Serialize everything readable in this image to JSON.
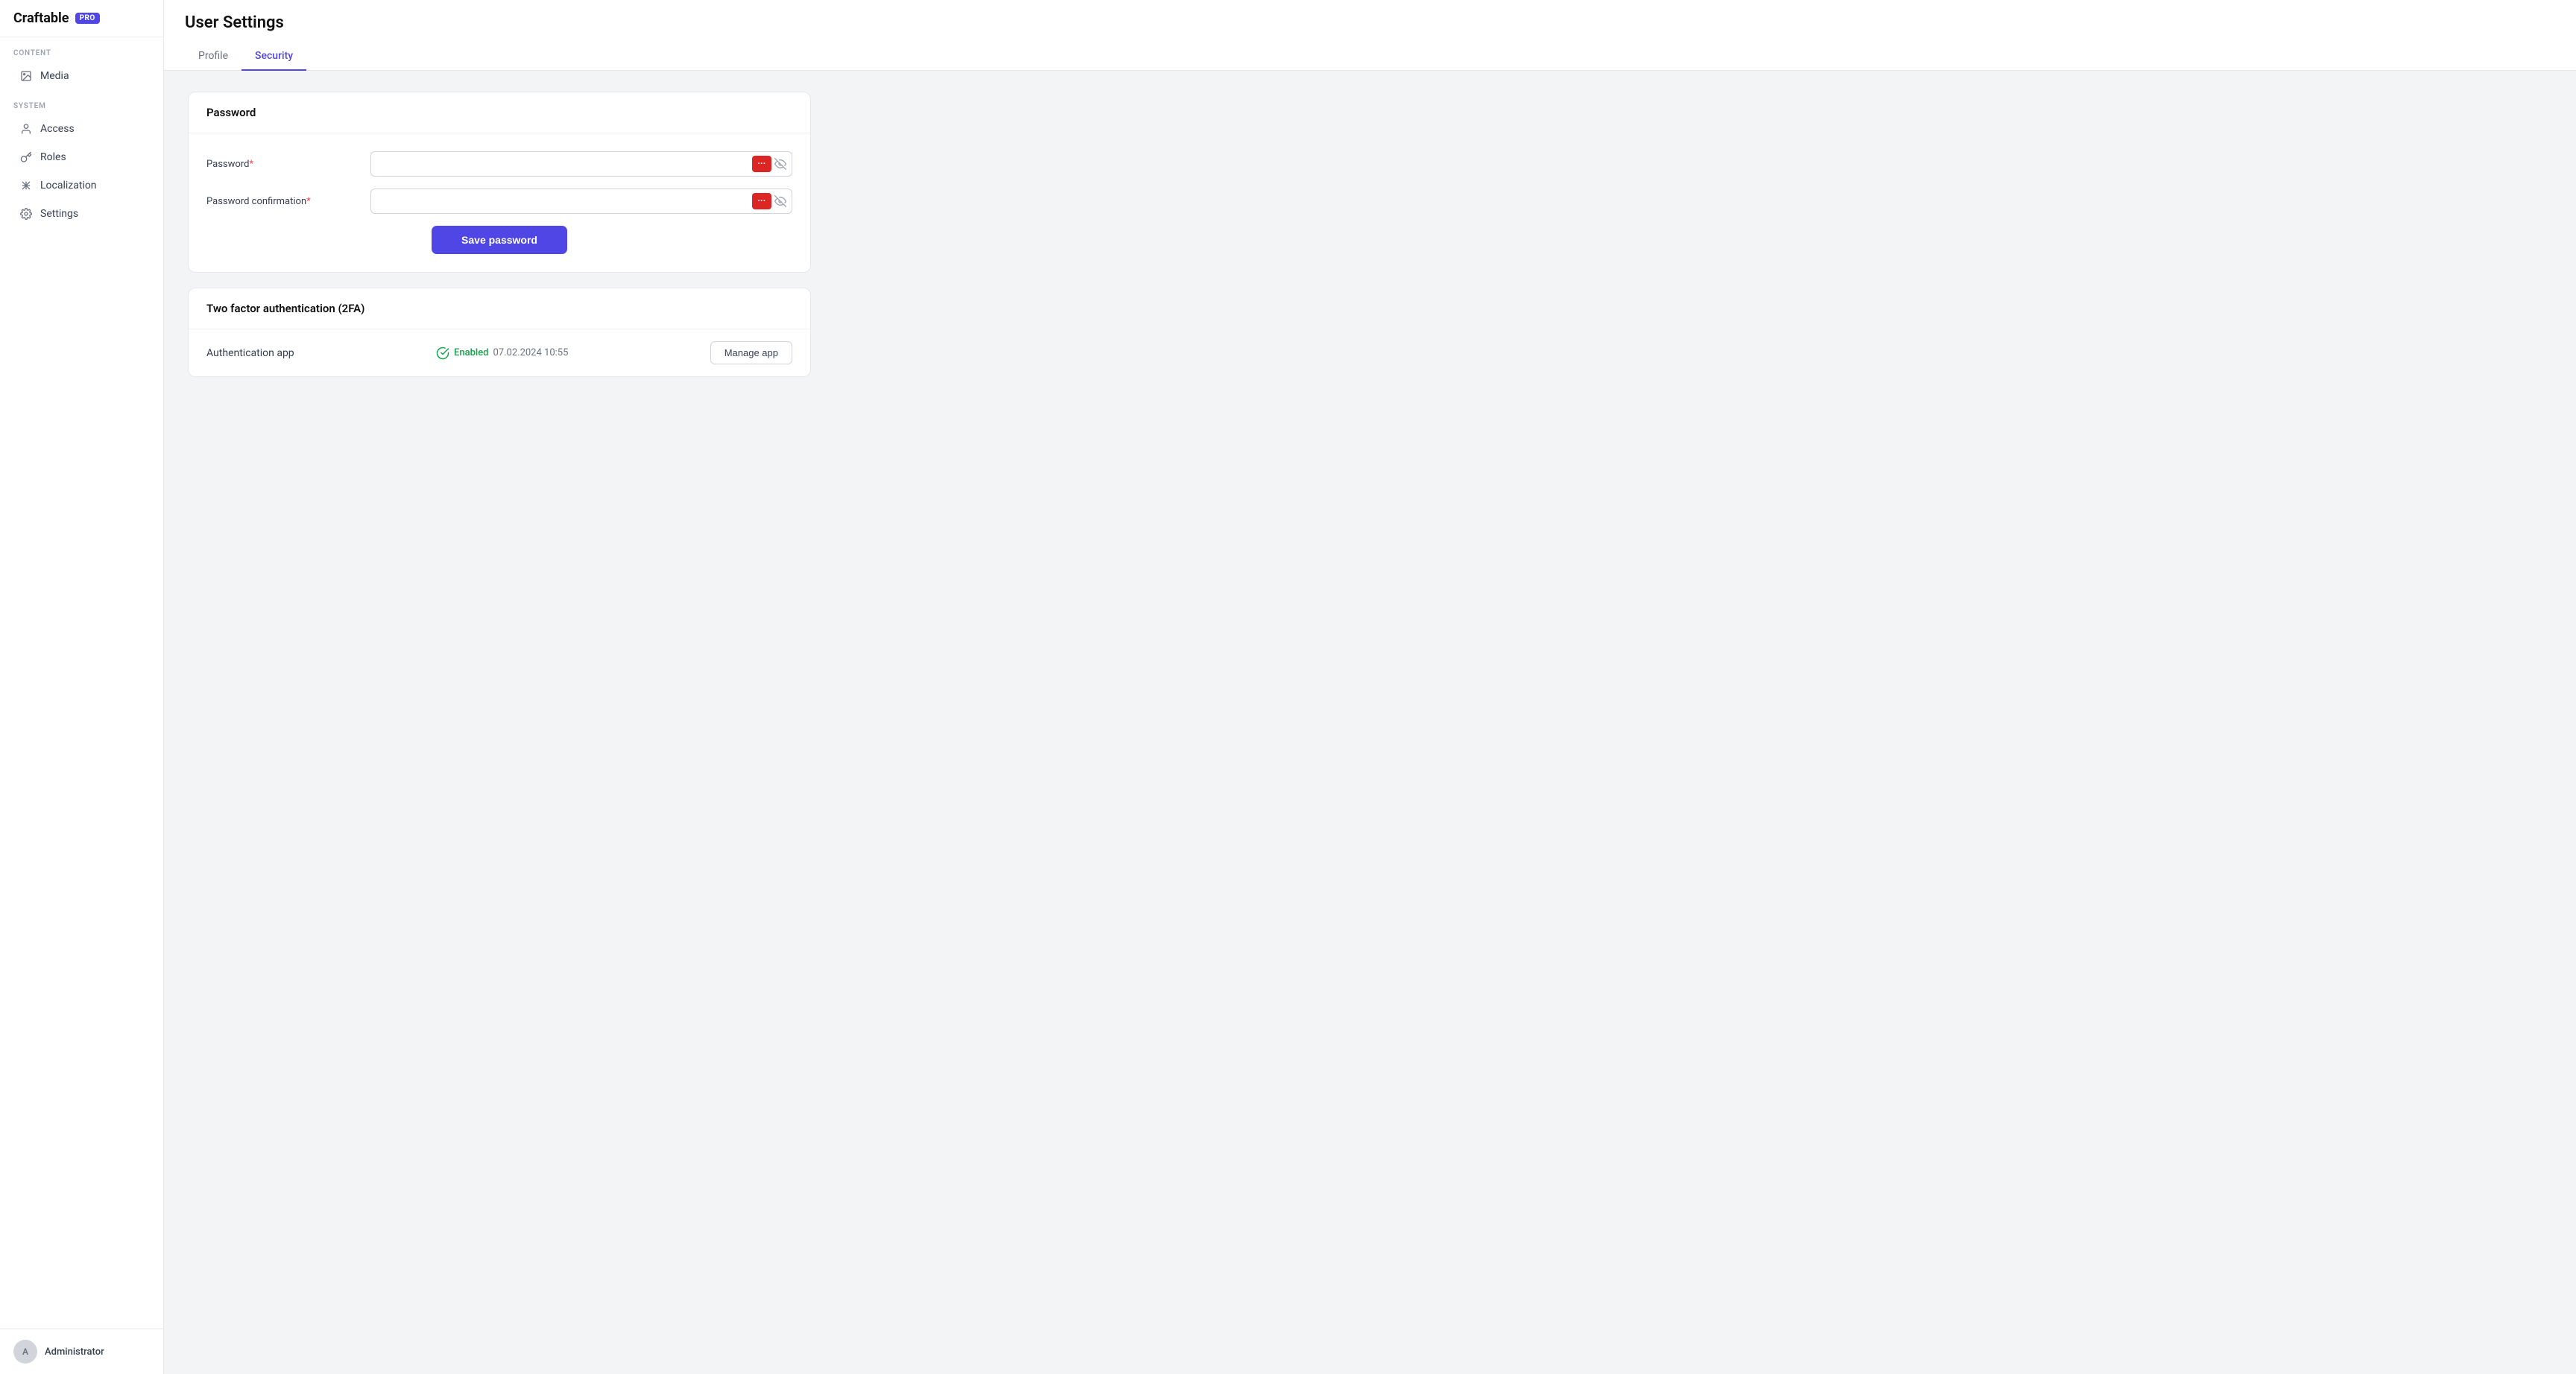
{
  "app": {
    "name": "Craftable",
    "badge": "PRO"
  },
  "sidebar": {
    "content_label": "CONTENT",
    "system_label": "SYSTEM",
    "items_content": [
      {
        "id": "media",
        "label": "Media",
        "icon": "image-icon"
      }
    ],
    "items_system": [
      {
        "id": "access",
        "label": "Access",
        "icon": "user-icon"
      },
      {
        "id": "roles",
        "label": "Roles",
        "icon": "key-icon"
      },
      {
        "id": "localization",
        "label": "Localization",
        "icon": "localization-icon"
      },
      {
        "id": "settings",
        "label": "Settings",
        "icon": "settings-icon"
      }
    ],
    "footer_user": "Administrator"
  },
  "page": {
    "title": "User Settings",
    "tabs": [
      {
        "id": "profile",
        "label": "Profile",
        "active": false
      },
      {
        "id": "security",
        "label": "Security",
        "active": true
      }
    ]
  },
  "password_section": {
    "title": "Password",
    "password_label": "Password",
    "password_required": "*",
    "password_confirmation_label": "Password confirmation",
    "password_confirmation_required": "*",
    "save_button": "Save password"
  },
  "twofa_section": {
    "title": "Two factor authentication (2FA)",
    "auth_app_label": "Authentication app",
    "status": "Enabled",
    "status_date": "07.02.2024 10:55",
    "manage_button": "Manage app"
  }
}
